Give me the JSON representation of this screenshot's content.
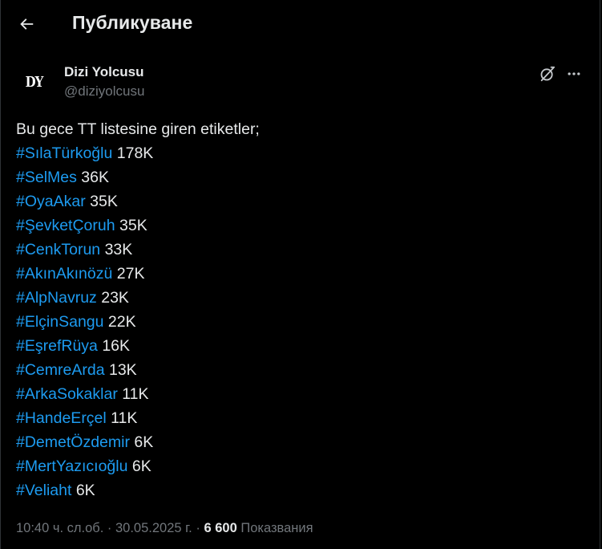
{
  "header": {
    "title": "Публикуване"
  },
  "post": {
    "author": {
      "avatar_text": "DY",
      "name": "Dizi Yolcusu",
      "handle": "@diziyolcusu"
    },
    "intro": "Bu gece TT listesine giren etiketler;",
    "tags": [
      {
        "tag": "#SılaTürkoğlu",
        "count": "178K"
      },
      {
        "tag": "#SelMes",
        "count": "36K"
      },
      {
        "tag": "#OyaAkar",
        "count": "35K"
      },
      {
        "tag": "#ŞevketÇoruh",
        "count": "35K"
      },
      {
        "tag": "#CenkTorun",
        "count": "33K"
      },
      {
        "tag": "#AkınAkınözü",
        "count": "27K"
      },
      {
        "tag": "#AlpNavruz",
        "count": "23K"
      },
      {
        "tag": "#ElçinSangu",
        "count": "22K"
      },
      {
        "tag": "#EşrefRüya",
        "count": "16K"
      },
      {
        "tag": "#CemreArda",
        "count": "13K"
      },
      {
        "tag": "#ArkaSokaklar",
        "count": "11K"
      },
      {
        "tag": "#HandeErçel",
        "count": "11K"
      },
      {
        "tag": "#DemetÖzdemir",
        "count": "6K"
      },
      {
        "tag": "#MertYazıcıoğlu",
        "count": "6K"
      },
      {
        "tag": "#Veliaht",
        "count": "6K"
      }
    ],
    "meta": {
      "time": "10:40 ч. сл.об.",
      "separator": "·",
      "date": "30.05.2025 г.",
      "views_count": "6 600",
      "views_label": "Показвания"
    }
  },
  "icons": {
    "back": "arrow-left-icon",
    "grok": "grok-icon",
    "more": "more-horizontal-icon"
  },
  "colors": {
    "background": "#000000",
    "text": "#e7e9ea",
    "muted": "#71767b",
    "accent": "#1d9bf0"
  }
}
